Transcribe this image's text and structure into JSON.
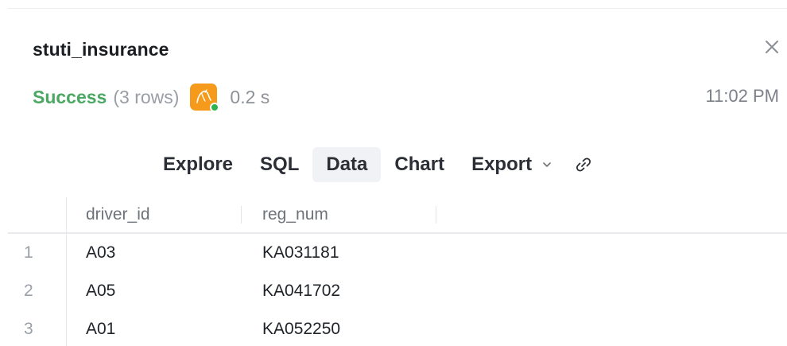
{
  "panel": {
    "title": "stuti_insurance",
    "close_icon": "close-icon"
  },
  "status": {
    "state": "Success",
    "rows_text": "(3 rows)",
    "db_icon": "mysql-dolphin-icon",
    "duration": "0.2 s",
    "time": "11:02 PM"
  },
  "tabs": [
    {
      "label": "Explore",
      "active": false
    },
    {
      "label": "SQL",
      "active": false
    },
    {
      "label": "Data",
      "active": true
    },
    {
      "label": "Chart",
      "active": false
    },
    {
      "label": "Export",
      "active": false,
      "has_dropdown": true
    }
  ],
  "link_icon": "link-icon",
  "table": {
    "columns": [
      "driver_id",
      "reg_num"
    ],
    "rows": [
      {
        "n": "1",
        "driver_id": "A03",
        "reg_num": "KA031181"
      },
      {
        "n": "2",
        "driver_id": "A05",
        "reg_num": "KA041702"
      },
      {
        "n": "3",
        "driver_id": "A01",
        "reg_num": "KA052250"
      }
    ]
  },
  "colors": {
    "success": "#4aa862",
    "db_tile": "#f59a1b",
    "online_dot": "#2fb350",
    "active_tab_bg": "#f0f2f5"
  }
}
